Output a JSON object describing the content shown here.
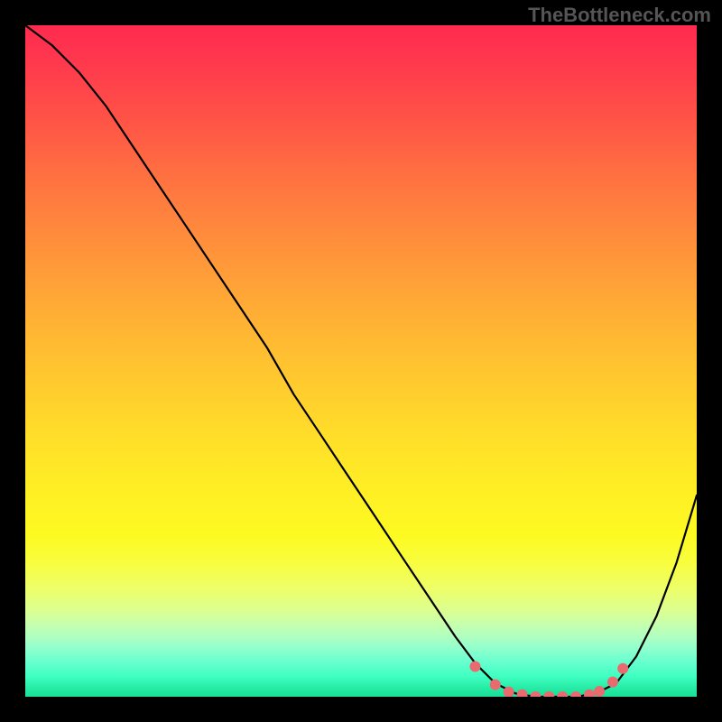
{
  "watermark": "TheBottleneck.com",
  "chart_data": {
    "type": "line",
    "title": "",
    "xlabel": "",
    "ylabel": "",
    "xlim": [
      0,
      100
    ],
    "ylim": [
      0,
      100
    ],
    "grid": false,
    "series": [
      {
        "name": "bottleneck-curve",
        "color": "#000000",
        "x": [
          0,
          4,
          8,
          12,
          16,
          20,
          24,
          28,
          32,
          36,
          40,
          44,
          48,
          52,
          56,
          60,
          64,
          67,
          70,
          73,
          76,
          79,
          82,
          85,
          88,
          91,
          94,
          97,
          100
        ],
        "values": [
          100,
          97,
          93,
          88,
          82,
          76,
          70,
          64,
          58,
          52,
          45,
          39,
          33,
          27,
          21,
          15,
          9,
          5,
          2,
          0.5,
          0,
          0,
          0,
          0.5,
          2,
          6,
          12,
          20,
          30
        ]
      }
    ],
    "marked_points": {
      "name": "flat-region-dots",
      "color": "#e96a6f",
      "x": [
        67,
        70,
        72,
        74,
        76,
        78,
        80,
        82,
        84,
        85.5,
        87.5,
        89
      ],
      "values": [
        4.5,
        1.8,
        0.7,
        0.3,
        0,
        0,
        0,
        0,
        0.3,
        0.8,
        2.2,
        4.2
      ]
    },
    "background_gradient": {
      "orientation": "vertical",
      "stops": [
        {
          "pos": 0.0,
          "color": "#ff2a4f"
        },
        {
          "pos": 0.5,
          "color": "#ffc830"
        },
        {
          "pos": 0.78,
          "color": "#fdfa22"
        },
        {
          "pos": 0.92,
          "color": "#a0ffc8"
        },
        {
          "pos": 1.0,
          "color": "#1adf98"
        }
      ]
    }
  }
}
